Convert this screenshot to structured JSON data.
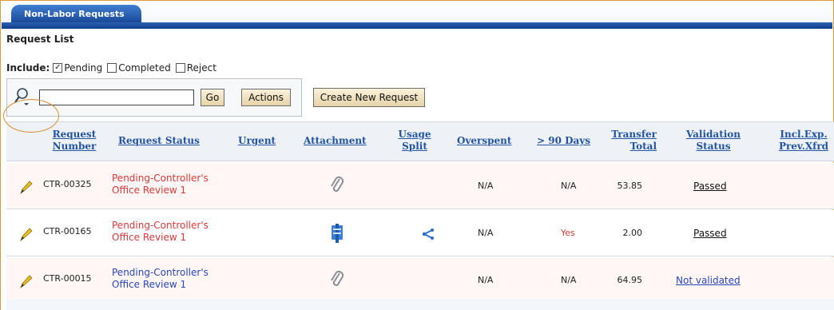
{
  "tab": {
    "label": "Non-Labor Requests"
  },
  "title": "Request List",
  "include": {
    "label": "Include:",
    "options": [
      {
        "label": "Pending",
        "checked": true
      },
      {
        "label": "Completed",
        "checked": false
      },
      {
        "label": "Reject",
        "checked": false
      }
    ]
  },
  "search": {
    "value": "",
    "go_label": "Go",
    "actions_label": "Actions"
  },
  "create_label": "Create New Request",
  "columns": {
    "request_number": [
      "Request",
      "Number"
    ],
    "request_status": "Request Status",
    "urgent": "Urgent",
    "attachment": "Attachment",
    "usage_split": [
      "Usage",
      "Split"
    ],
    "overspent": "Overspent",
    "over_90_days": "> 90 Days",
    "transfer_total": [
      "Transfer",
      "Total"
    ],
    "validation_status": [
      "Validation",
      "Status"
    ],
    "incl_exp": [
      "Incl.Exp.",
      "Prev.Xfrd"
    ]
  },
  "rows": [
    {
      "number": "CTR-00325",
      "status": [
        "Pending-Controller's",
        "Office Review 1"
      ],
      "attachment_icon": "paperclip-icon",
      "overspent": "N/A",
      "over_90_days": "N/A",
      "transfer_total": "53.85",
      "validation": "Passed"
    },
    {
      "number": "CTR-00165",
      "status": [
        "Pending-Controller's",
        "Office Review 1"
      ],
      "attachment_icon": "document-icon",
      "usage_icon": "share-icon",
      "overspent": "N/A",
      "over_90_days": "Yes",
      "transfer_total": "2.00",
      "validation": "Passed"
    },
    {
      "number": "CTR-00015",
      "status": [
        "Pending-Controller's",
        "Office Review 1"
      ],
      "attachment_icon": "paperclip-icon",
      "overspent": "N/A",
      "over_90_days": "N/A",
      "transfer_total": "64.95",
      "validation": "Not validated"
    }
  ],
  "colors": {
    "tab_blue": "#143f8f",
    "status_red": "#d93a3a",
    "status_blue": "#2a46b8",
    "header_text": "#2254a3"
  }
}
